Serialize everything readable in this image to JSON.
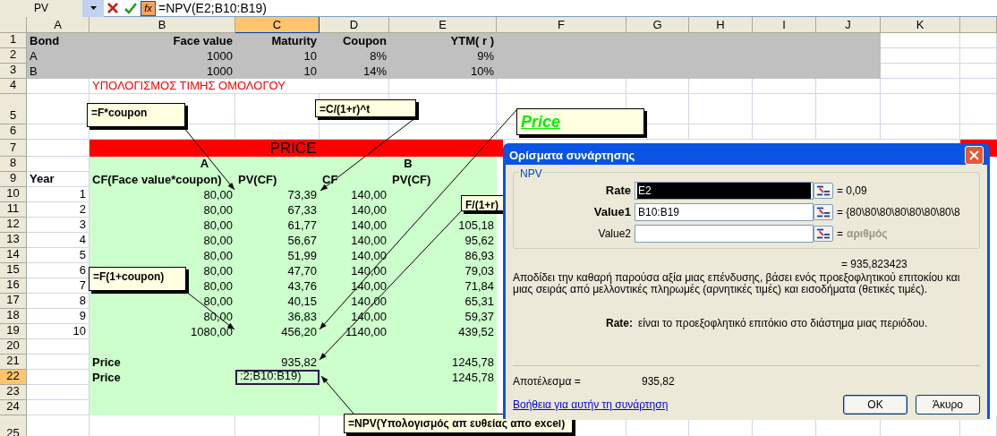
{
  "formula_bar": {
    "name_box": "PV",
    "fx_label": "fx",
    "formula": "=NPV(E2;B10:B19)"
  },
  "columns": [
    {
      "label": "A",
      "selected": false
    },
    {
      "label": "B",
      "selected": false
    },
    {
      "label": "C",
      "selected": true
    },
    {
      "label": "D",
      "selected": false
    },
    {
      "label": "E",
      "selected": false
    },
    {
      "label": "F",
      "selected": false
    },
    {
      "label": "G",
      "selected": false
    },
    {
      "label": "H",
      "selected": false
    },
    {
      "label": "I",
      "selected": false
    },
    {
      "label": "J",
      "selected": false
    },
    {
      "label": "K",
      "selected": false
    }
  ],
  "rows": [
    {
      "number": "1",
      "selected": false,
      "kind": "header_bold",
      "cells": {
        "A": "Bond",
        "B": "Face value",
        "C": "Maturity",
        "D": "Coupon",
        "E": "YTM( r )"
      }
    },
    {
      "number": "2",
      "selected": false,
      "kind": "header",
      "cells": {
        "A": "A",
        "B": "1000",
        "C": "10",
        "D": "8%",
        "E": "9%"
      }
    },
    {
      "number": "3",
      "selected": false,
      "kind": "header",
      "cells": {
        "A": "B",
        "B": "1000",
        "C": "10",
        "D": "14%",
        "E": "10%"
      }
    },
    {
      "number": "4",
      "selected": false,
      "kind": "title",
      "cells": {
        "B": "ΥΠΟΛΟΓΙΣΜΟΣ ΤΙΜΗΣ ΟΜΟΛΟΓΟΥ"
      }
    },
    {
      "number": "5",
      "selected": false,
      "kind": "blank",
      "cells": {}
    },
    {
      "number": "6",
      "selected": false,
      "kind": "blank",
      "cells": {}
    },
    {
      "number": "7",
      "selected": false,
      "kind": "banner",
      "cells": {
        "B": "PRICE"
      }
    },
    {
      "number": "8",
      "selected": false,
      "kind": "group",
      "cells": {
        "B": "A",
        "D": "B"
      }
    },
    {
      "number": "9",
      "selected": false,
      "kind": "labels",
      "cells": {
        "A": "Year",
        "B": "CF(Face value*coupon)",
        "C": "PV(CF)",
        "D": "CF",
        "E": "PV(CF)"
      }
    },
    {
      "number": "10",
      "selected": false,
      "kind": "data",
      "cells": {
        "A": "1",
        "B": "80,00",
        "C": "73,39",
        "D": "140,00"
      }
    },
    {
      "number": "11",
      "selected": false,
      "kind": "data",
      "cells": {
        "A": "2",
        "B": "80,00",
        "C": "67,33",
        "D": "140,00"
      }
    },
    {
      "number": "12",
      "selected": false,
      "kind": "data",
      "cells": {
        "A": "3",
        "B": "80,00",
        "C": "61,77",
        "D": "140,00",
        "E": "105,18"
      }
    },
    {
      "number": "13",
      "selected": false,
      "kind": "data",
      "cells": {
        "A": "4",
        "B": "80,00",
        "C": "56,67",
        "D": "140,00",
        "E": "95,62"
      }
    },
    {
      "number": "14",
      "selected": false,
      "kind": "data",
      "cells": {
        "A": "5",
        "B": "80,00",
        "C": "51,99",
        "D": "140,00",
        "E": "86,93"
      }
    },
    {
      "number": "15",
      "selected": false,
      "kind": "data",
      "cells": {
        "A": "6",
        "B": "80,00",
        "C": "47,70",
        "D": "140,00",
        "E": "79,03"
      }
    },
    {
      "number": "16",
      "selected": false,
      "kind": "data",
      "cells": {
        "A": "7",
        "B": "80,00",
        "C": "43,76",
        "D": "140,00",
        "E": "71,84"
      }
    },
    {
      "number": "17",
      "selected": false,
      "kind": "data",
      "cells": {
        "A": "8",
        "B": "80,00",
        "C": "40,15",
        "D": "140,00",
        "E": "65,31"
      }
    },
    {
      "number": "18",
      "selected": false,
      "kind": "data",
      "cells": {
        "A": "9",
        "B": "80,00",
        "C": "36,83",
        "D": "140,00",
        "E": "59,37"
      }
    },
    {
      "number": "19",
      "selected": false,
      "kind": "data",
      "cells": {
        "A": "10",
        "B": "1080,00",
        "C": "456,20",
        "D": "1140,00",
        "E": "439,52"
      }
    },
    {
      "number": "20",
      "selected": false,
      "kind": "table_blank",
      "cells": {}
    },
    {
      "number": "21",
      "selected": false,
      "kind": "total",
      "cells": {
        "B": "Price",
        "C": "935,82",
        "E": "1245,78"
      }
    },
    {
      "number": "22",
      "selected": true,
      "kind": "total",
      "cells": {
        "B": "Price",
        "C": ":2;B10:B19)",
        "E": "1245,78"
      }
    },
    {
      "number": "23",
      "selected": false,
      "kind": "table_blank",
      "cells": {}
    },
    {
      "number": "24",
      "selected": false,
      "kind": "table_blank",
      "cells": {}
    },
    {
      "number": "25",
      "selected": false,
      "kind": "blank",
      "cells": {}
    }
  ],
  "callouts": [
    {
      "kind": "note",
      "text": "=F*coupon"
    },
    {
      "kind": "note",
      "text": "=C/(1+r)^t"
    },
    {
      "kind": "title",
      "text": "Price"
    },
    {
      "kind": "note",
      "text": "F/(1+r)"
    },
    {
      "kind": "note",
      "text": "=F(1+coupon)"
    },
    {
      "kind": "note",
      "text": "=NPV(Υπολογισμός απ ευθείας απο excel)"
    }
  ],
  "dialog": {
    "title": "Ορίσματα συνάρτησης",
    "group": "NPV",
    "arguments": [
      {
        "label": "Rate",
        "required": true,
        "value": "E2",
        "selected": true,
        "result": "= 0,09"
      },
      {
        "label": "Value1",
        "required": true,
        "value": "B10:B19",
        "selected": false,
        "result": "= {80\\80\\80\\80\\80\\80\\80\\8"
      },
      {
        "label": "Value2",
        "required": false,
        "result": "=",
        "hint": "αριθμός"
      }
    ],
    "formula_result": "= 935,823423",
    "description": "Αποδίδει την καθαρή παρούσα αξία μιας επένδυσης, βάσει ενός προεξοφλητικού επιτοκίου και μιας σειράς από μελλοντικές πληρωμές (αρνητικές τιμές) και εισοδήματα (θετικές τιμές).",
    "argument_help": {
      "label": "Rate:",
      "text": "είναι το προεξοφλητικό επιτόκιο στο διάστημα μιας περιόδου."
    },
    "result_label": "Αποτέλεσμα =",
    "result_value": "935,82",
    "help_link": "Βοήθεια για αυτήν τη συνάρτηση",
    "buttons": [
      "OK",
      "Άκυρο"
    ]
  }
}
